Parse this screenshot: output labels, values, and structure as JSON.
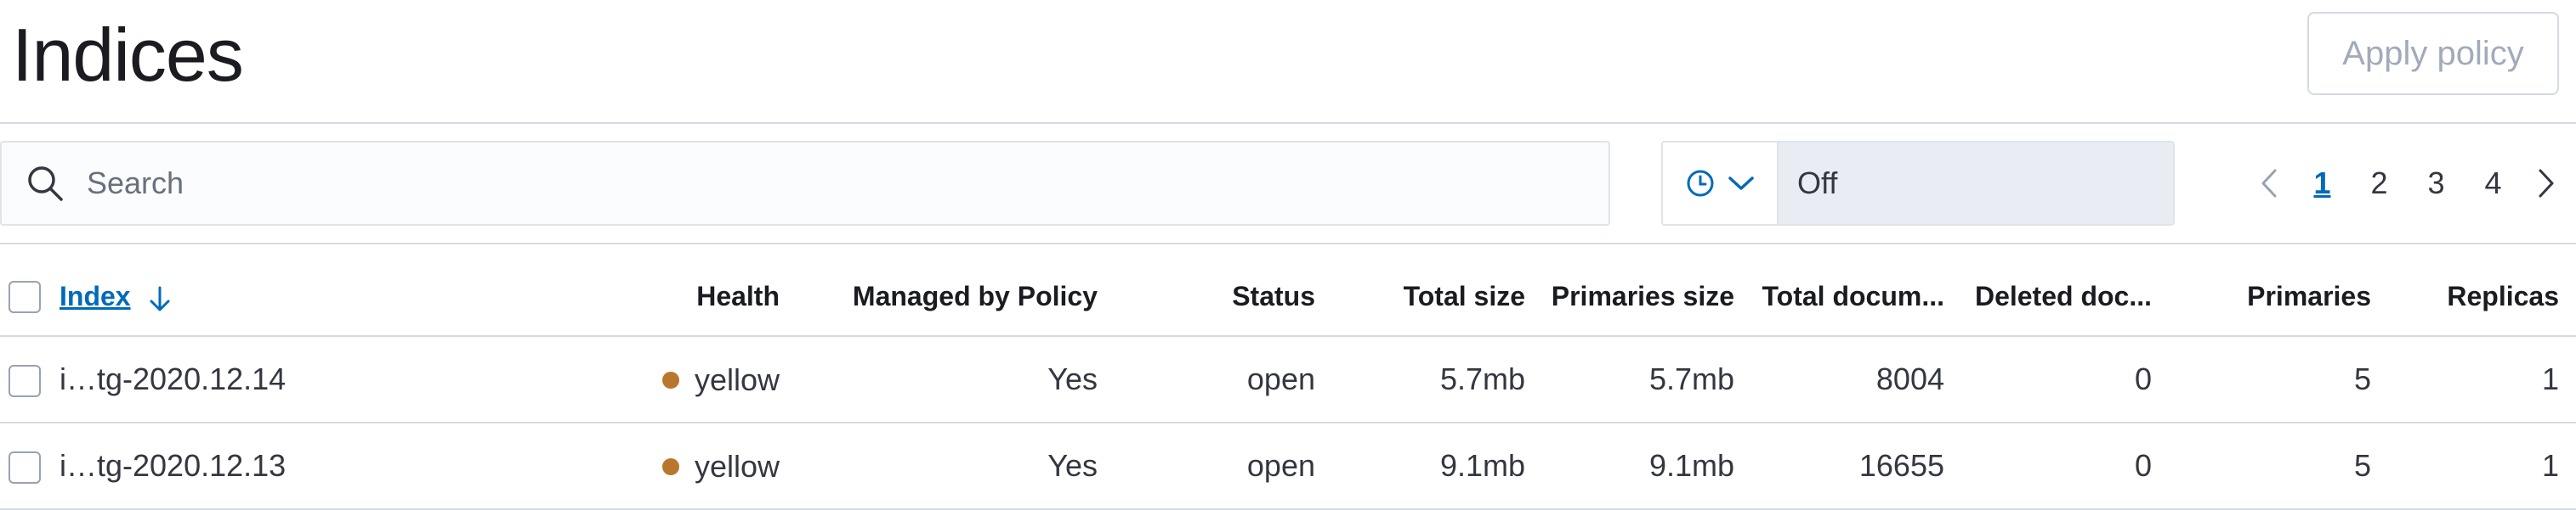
{
  "header": {
    "title": "Indices",
    "apply_policy_label": "Apply policy"
  },
  "search": {
    "placeholder": "Search",
    "value": ""
  },
  "refresh": {
    "value": "Off"
  },
  "pagination": {
    "pages": [
      "1",
      "2",
      "3",
      "4"
    ],
    "current": "1"
  },
  "colors": {
    "accent": "#006bb8",
    "health_yellow": "#b9772e"
  },
  "icons": {
    "search": "search-icon",
    "clock": "clock-icon",
    "chevron_down": "chevron-down-icon",
    "sort_desc": "arrow-down-icon",
    "page_prev": "chevron-left-icon",
    "page_next": "chevron-right-icon"
  },
  "table": {
    "columns": {
      "index": "Index",
      "health": "Health",
      "managed": "Managed by Policy",
      "status": "Status",
      "total_size": "Total size",
      "primaries_size": "Primaries size",
      "total_docs": "Total docum...",
      "deleted_docs": "Deleted doc...",
      "primaries": "Primaries",
      "replicas": "Replicas"
    },
    "rows": [
      {
        "index": "i…tg-2020.12.14",
        "health": "yellow",
        "managed": "Yes",
        "status": "open",
        "total_size": "5.7mb",
        "primaries_size": "5.7mb",
        "total_docs": "8004",
        "deleted_docs": "0",
        "primaries": "5",
        "replicas": "1"
      },
      {
        "index": "i…tg-2020.12.13",
        "health": "yellow",
        "managed": "Yes",
        "status": "open",
        "total_size": "9.1mb",
        "primaries_size": "9.1mb",
        "total_docs": "16655",
        "deleted_docs": "0",
        "primaries": "5",
        "replicas": "1"
      }
    ]
  }
}
